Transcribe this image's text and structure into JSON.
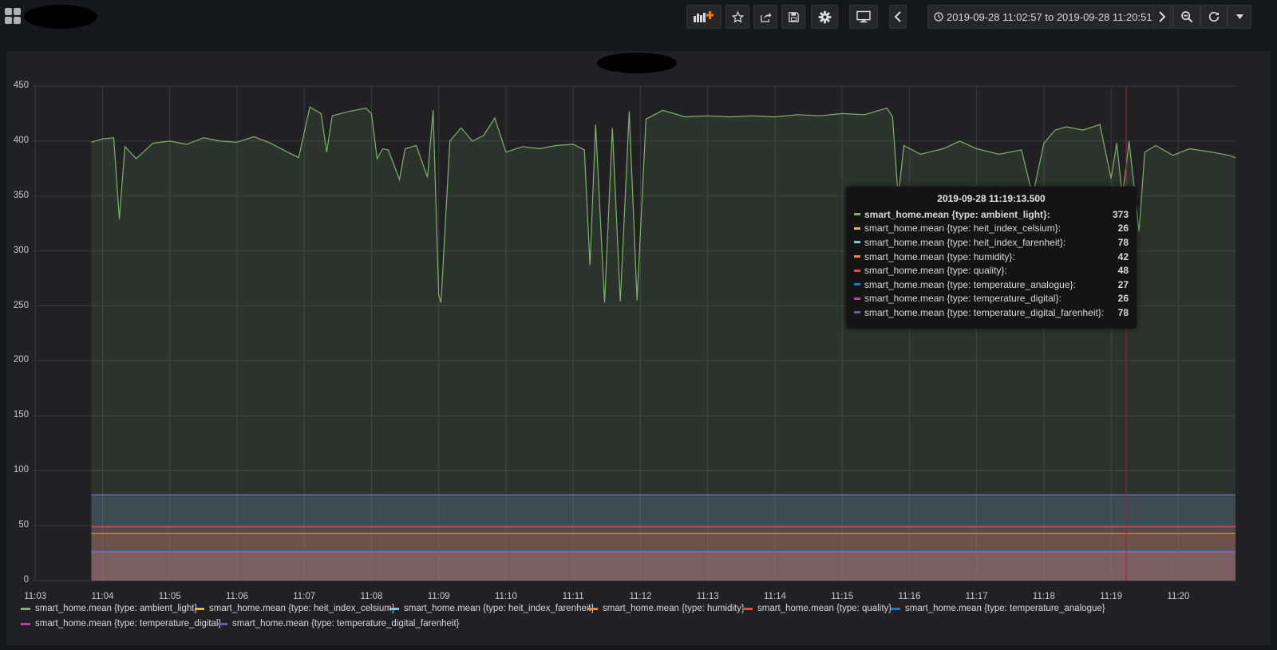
{
  "toolbar": {
    "icons": [
      "dashboard-grid-icon",
      "add-panel-icon",
      "star-icon",
      "share-icon",
      "save-icon",
      "settings-icon",
      "tv-mode-icon",
      "chevron-left-icon",
      "clock-icon",
      "chevron-right-icon",
      "zoom-out-icon",
      "refresh-icon",
      "caret-down-icon"
    ],
    "time_range": "2019-09-28 11:02:57 to 2019-09-28 11:20:51"
  },
  "colors": {
    "background": "#161719",
    "panel": "#212124",
    "ambient_light": "#7eb26d",
    "heit_index_celsius": "#eab839",
    "heit_index_farenheit": "#6ed0e0",
    "humidity": "#ef843c",
    "quality": "#e24d42",
    "temperature_analogue": "#1f78c1",
    "temperature_digital": "#ba43a9",
    "temperature_digital_farenheit": "#705da0",
    "hover_line": "#c4162a"
  },
  "chart_data": {
    "type": "line",
    "fill": true,
    "grid": true,
    "ylim": [
      0,
      450
    ],
    "y_ticks": [
      "0",
      "50",
      "100",
      "150",
      "200",
      "250",
      "300",
      "350",
      "400",
      "450"
    ],
    "x_ticks": [
      "11:03",
      "11:04",
      "11:05",
      "11:06",
      "11:07",
      "11:08",
      "11:09",
      "11:10",
      "11:11",
      "11:12",
      "11:13",
      "11:14",
      "11:15",
      "11:16",
      "11:17",
      "11:18",
      "11:19",
      "11:20"
    ],
    "x_range": [
      "11:02:57",
      "11:20:51"
    ],
    "legend_position": "bottom",
    "series": [
      {
        "name": "smart_home.mean {type: ambient_light}",
        "color": "#7eb26d",
        "points": [
          [
            "11:03:50",
            399
          ],
          [
            "11:04:00",
            402
          ],
          [
            "11:04:10",
            403
          ],
          [
            "11:04:15",
            329
          ],
          [
            "11:04:20",
            395
          ],
          [
            "11:04:30",
            384
          ],
          [
            "11:04:45",
            398
          ],
          [
            "11:05:00",
            400
          ],
          [
            "11:05:15",
            397
          ],
          [
            "11:05:30",
            403
          ],
          [
            "11:05:45",
            400
          ],
          [
            "11:06:00",
            399
          ],
          [
            "11:06:15",
            404
          ],
          [
            "11:06:30",
            398
          ],
          [
            "11:06:45",
            390
          ],
          [
            "11:06:55",
            385
          ],
          [
            "11:07:00",
            408
          ],
          [
            "11:07:05",
            431
          ],
          [
            "11:07:15",
            425
          ],
          [
            "11:07:20",
            390
          ],
          [
            "11:07:25",
            423
          ],
          [
            "11:07:40",
            427
          ],
          [
            "11:07:55",
            430
          ],
          [
            "11:08:00",
            425
          ],
          [
            "11:08:05",
            384
          ],
          [
            "11:08:10",
            393
          ],
          [
            "11:08:15",
            392
          ],
          [
            "11:08:25",
            365
          ],
          [
            "11:08:30",
            393
          ],
          [
            "11:08:40",
            396
          ],
          [
            "11:08:50",
            367
          ],
          [
            "11:08:55",
            428
          ],
          [
            "11:09:00",
            260
          ],
          [
            "11:09:02",
            253
          ],
          [
            "11:09:10",
            400
          ],
          [
            "11:09:20",
            412
          ],
          [
            "11:09:30",
            400
          ],
          [
            "11:09:40",
            405
          ],
          [
            "11:09:50",
            421
          ],
          [
            "11:10:00",
            390
          ],
          [
            "11:10:15",
            395
          ],
          [
            "11:10:30",
            393
          ],
          [
            "11:10:45",
            396
          ],
          [
            "11:11:00",
            397
          ],
          [
            "11:11:10",
            392
          ],
          [
            "11:11:15",
            287
          ],
          [
            "11:11:20",
            415
          ],
          [
            "11:11:28",
            253
          ],
          [
            "11:11:35",
            412
          ],
          [
            "11:11:42",
            254
          ],
          [
            "11:11:50",
            427
          ],
          [
            "11:11:57",
            255
          ],
          [
            "11:12:05",
            420
          ],
          [
            "11:12:20",
            428
          ],
          [
            "11:12:40",
            422
          ],
          [
            "11:13:00",
            423
          ],
          [
            "11:13:20",
            422
          ],
          [
            "11:13:40",
            423
          ],
          [
            "11:14:00",
            422
          ],
          [
            "11:14:20",
            424
          ],
          [
            "11:14:40",
            423
          ],
          [
            "11:15:00",
            425
          ],
          [
            "11:15:20",
            424
          ],
          [
            "11:15:40",
            430
          ],
          [
            "11:15:45",
            422
          ],
          [
            "11:15:50",
            348
          ],
          [
            "11:15:55",
            396
          ],
          [
            "11:16:10",
            388
          ],
          [
            "11:16:30",
            393
          ],
          [
            "11:16:45",
            400
          ],
          [
            "11:17:00",
            393
          ],
          [
            "11:17:20",
            388
          ],
          [
            "11:17:40",
            392
          ],
          [
            "11:17:50",
            350
          ],
          [
            "11:18:00",
            398
          ],
          [
            "11:18:10",
            410
          ],
          [
            "11:18:20",
            413
          ],
          [
            "11:18:35",
            410
          ],
          [
            "11:18:50",
            415
          ],
          [
            "11:19:00",
            366
          ],
          [
            "11:19:05",
            398
          ],
          [
            "11:19:10",
            350
          ],
          [
            "11:19:13",
            373
          ],
          [
            "11:19:16",
            400
          ],
          [
            "11:19:25",
            318
          ],
          [
            "11:19:30",
            390
          ],
          [
            "11:19:40",
            396
          ],
          [
            "11:19:55",
            387
          ],
          [
            "11:20:10",
            393
          ],
          [
            "11:20:30",
            390
          ],
          [
            "11:20:45",
            387
          ],
          [
            "11:20:51",
            385
          ]
        ]
      },
      {
        "name": "smart_home.mean {type: heit_index_celsius}",
        "color": "#eab839",
        "value": 26
      },
      {
        "name": "smart_home.mean {type: heit_index_farenheit}",
        "color": "#6ed0e0",
        "value": 78
      },
      {
        "name": "smart_home.mean {type: humidity}",
        "color": "#ef843c",
        "value": 43
      },
      {
        "name": "smart_home.mean {type: quality}",
        "color": "#e24d42",
        "value": 49
      },
      {
        "name": "smart_home.mean {type: temperature_analogue}",
        "color": "#1f78c1",
        "value": 27
      },
      {
        "name": "smart_home.mean {type: temperature_digital}",
        "color": "#ba43a9",
        "value": 26
      },
      {
        "name": "smart_home.mean {type: temperature_digital_farenheit}",
        "color": "#705da0",
        "value": 78
      }
    ],
    "series_start": "11:03:50",
    "hover_time": "11:19:13.5"
  },
  "tooltip": {
    "title": "2019-09-28 11:19:13.500",
    "rows": [
      {
        "label": "smart_home.mean {type: ambient_light}:",
        "value": "373",
        "color": "#7eb26d"
      },
      {
        "label": "smart_home.mean {type: heit_index_celsium}:",
        "value": "26",
        "color": "#eab839"
      },
      {
        "label": "smart_home.mean {type: heit_index_farenheit}:",
        "value": "78",
        "color": "#6ed0e0"
      },
      {
        "label": "smart_home.mean {type: humidity}:",
        "value": "42",
        "color": "#ef843c"
      },
      {
        "label": "smart_home.mean {type: quality}:",
        "value": "48",
        "color": "#e24d42"
      },
      {
        "label": "smart_home.mean {type: temperature_analogue}:",
        "value": "27",
        "color": "#1f78c1"
      },
      {
        "label": "smart_home.mean {type: temperature_digital}:",
        "value": "26",
        "color": "#ba43a9"
      },
      {
        "label": "smart_home.mean {type: temperature_digital_farenheit}:",
        "value": "78",
        "color": "#705da0"
      }
    ]
  },
  "legend": [
    {
      "label": "smart_home.mean {type: ambient_light}",
      "color": "#7eb26d"
    },
    {
      "label": "smart_home.mean {type: heit_index_celsium}",
      "color": "#eab839"
    },
    {
      "label": "smart_home.mean {type: heit_index_farenheit}",
      "color": "#6ed0e0"
    },
    {
      "label": "smart_home.mean {type: humidity}",
      "color": "#ef843c"
    },
    {
      "label": "smart_home.mean {type: quality}",
      "color": "#e24d42"
    },
    {
      "label": "smart_home.mean {type: temperature_analogue}",
      "color": "#1f78c1"
    },
    {
      "label": "smart_home.mean {type: temperature_digital}",
      "color": "#ba43a9"
    },
    {
      "label": "smart_home.mean {type: temperature_digital_farenheit}",
      "color": "#705da0"
    }
  ]
}
